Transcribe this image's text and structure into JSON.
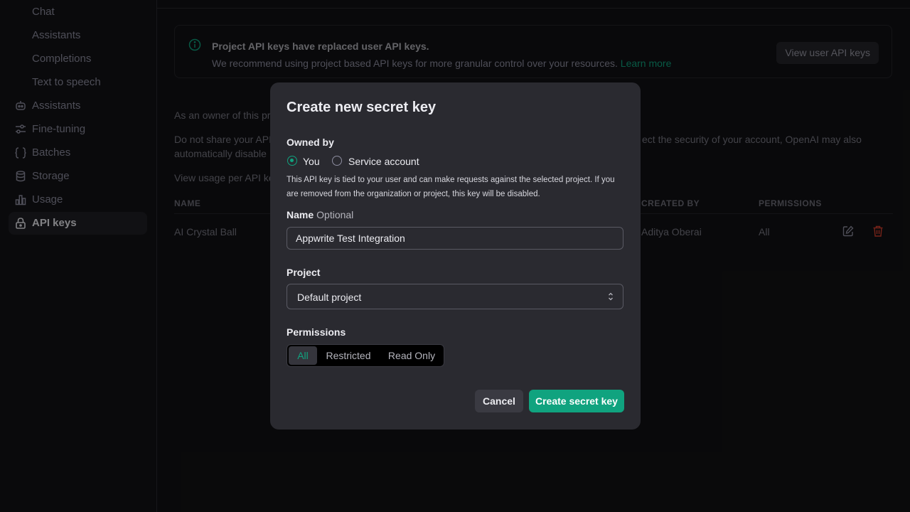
{
  "sidebar": {
    "items": [
      {
        "label": "Chat",
        "sub": true
      },
      {
        "label": "Assistants",
        "sub": true
      },
      {
        "label": "Completions",
        "sub": true
      },
      {
        "label": "Text to speech",
        "sub": true
      },
      {
        "label": "Assistants",
        "icon": "robot-icon"
      },
      {
        "label": "Fine-tuning",
        "icon": "sliders-icon"
      },
      {
        "label": "Batches",
        "icon": "braces-icon"
      },
      {
        "label": "Storage",
        "icon": "database-icon"
      },
      {
        "label": "Usage",
        "icon": "bar-chart-icon"
      },
      {
        "label": "API keys",
        "icon": "lock-icon",
        "active": true
      }
    ]
  },
  "banner": {
    "title": "Project API keys have replaced user API keys.",
    "body": "We recommend using project based API keys for more granular control over your resources.",
    "link": "Learn more",
    "button": "View user API keys"
  },
  "background": {
    "owner_text": "As an owner of this pr",
    "share_text_1": "Do not share your API",
    "share_text_2": "automatically disable",
    "share_text_right": "ect the security of your account, OpenAI may also",
    "usage_text": "View usage per API ke"
  },
  "table": {
    "headers": {
      "name": "NAME",
      "created_by": "CREATED BY",
      "permissions": "PERMISSIONS"
    },
    "rows": [
      {
        "name": "AI Crystal Ball",
        "created_by": "Aditya Oberai",
        "permissions": "All"
      }
    ]
  },
  "modal": {
    "title": "Create new secret key",
    "owned_by_label": "Owned by",
    "owner_options": [
      "You",
      "Service account"
    ],
    "owner_selected": "You",
    "description": "This API key is tied to your user and can make requests against the selected project. If you are removed from the organization or project, this key will be disabled.",
    "name_label": "Name",
    "name_optional": "Optional",
    "name_value": "Appwrite Test Integration",
    "project_label": "Project",
    "project_value": "Default project",
    "permissions_label": "Permissions",
    "permission_options": [
      "All",
      "Restricted",
      "Read Only"
    ],
    "permission_selected": "All",
    "cancel_label": "Cancel",
    "create_label": "Create secret key"
  },
  "colors": {
    "accent": "#10a37f",
    "danger": "#d9412f",
    "modal_bg": "#2a2a30",
    "page_bg": "#121214"
  }
}
